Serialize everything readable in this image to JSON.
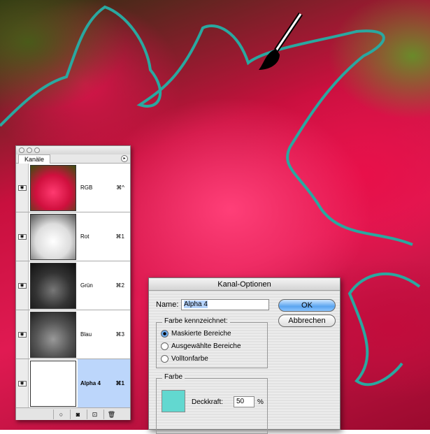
{
  "panel": {
    "tab": "Kanäle",
    "menu_icon": "▸",
    "channels": [
      {
        "name": "RGB",
        "shortcut": "⌘^",
        "thumb": "color"
      },
      {
        "name": "Rot",
        "shortcut": "⌘1",
        "thumb": "light"
      },
      {
        "name": "Grün",
        "shortcut": "⌘2",
        "thumb": "mid"
      },
      {
        "name": "Blau",
        "shortcut": "⌘3",
        "thumb": "dark"
      },
      {
        "name": "Alpha 4",
        "shortcut": "⌘1",
        "thumb": "mask",
        "selected": true
      }
    ],
    "bottom_buttons": [
      "○",
      "◙",
      "⊡",
      "🗑"
    ]
  },
  "dialog": {
    "title": "Kanal-Optionen",
    "name_label": "Name:",
    "name_value": "Alpha 4",
    "ok": "OK",
    "cancel": "Abbrechen",
    "group1": "Farbe kennzeichnet:",
    "options": [
      "Maskierte Bereiche",
      "Ausgewählte Bereiche",
      "Volltonfarbe"
    ],
    "selected_option": 0,
    "group2": "Farbe",
    "opacity_label": "Deckkraft:",
    "opacity_value": "50",
    "percent": "%",
    "color": "#62d8d0"
  },
  "mask_outline_color": "#2aa8a0"
}
